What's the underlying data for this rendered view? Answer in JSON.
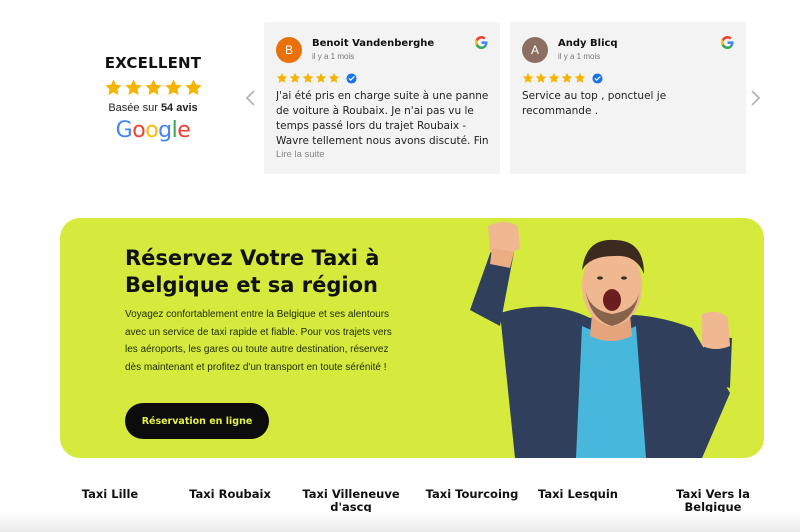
{
  "rating": {
    "title": "EXCELLENT",
    "stars": 5,
    "based_prefix": "Basée sur",
    "count": "54 avis",
    "provider": "Google",
    "star_color": "#f5b400"
  },
  "reviews": [
    {
      "initial": "B",
      "name": "Benoit Vandenberghe",
      "time": "il y a 1 mois",
      "stars": 5,
      "text": "J'ai été pris en charge suite à une panne de voiture à Roubaix. Je n'ai pas vu le temps passé lors du trajet Roubaix - Wavre tellement nous avons discuté. Fin de journé...",
      "read_more": "Lire la suite",
      "avatar_color": "#e8710a"
    },
    {
      "initial": "A",
      "name": "Andy Blicq",
      "time": "il y a 1 mois",
      "stars": 5,
      "text": "Service au top , ponctuel je recommande .",
      "avatar_color": "#8d6e63"
    }
  ],
  "hero": {
    "title": "Réservez Votre Taxi à Belgique et sa région",
    "description": "Voyagez confortablement entre la Belgique et ses alentours avec un service de taxi rapide et fiable. Pour vos trajets vers les aéroports, les gares ou toute autre destination, réservez dès maintenant et profitez d'un transport en toute sérénité !",
    "cta": "Réservation en ligne",
    "background": "#d5ea3c"
  },
  "taxi_links": [
    "Taxi Lille",
    "Taxi Roubaix",
    "Taxi Villeneuve d'ascq",
    "Taxi Tourcoing",
    "Taxi Lesquin",
    "Taxi Vers la Belgique"
  ]
}
